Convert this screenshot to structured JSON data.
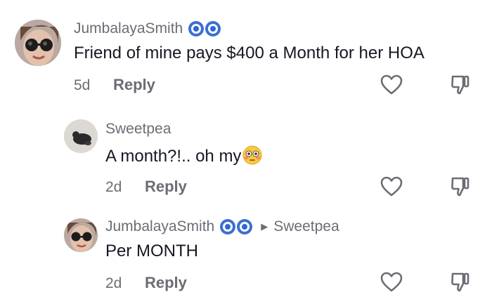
{
  "comments": [
    {
      "username": "JumbalayaSmith",
      "text": "Friend of mine pays $400 a Month for her HOA",
      "time": "5d",
      "reply_label": "Reply"
    },
    {
      "username": "Sweetpea",
      "text": "A month?!.. oh my",
      "time": "2d",
      "reply_label": "Reply"
    },
    {
      "username": "JumbalayaSmith",
      "reply_to": "Sweetpea",
      "text": "Per MONTH",
      "time": "2d",
      "reply_label": "Reply"
    }
  ],
  "colors": {
    "text": "#161823",
    "muted": "#6b6d74",
    "badge": "#3b6fd3"
  },
  "icons": [
    "verified-eye-badge-icon",
    "heart-icon",
    "dislike-icon",
    "flushed-face-emoji-icon",
    "reply-arrow-icon"
  ]
}
